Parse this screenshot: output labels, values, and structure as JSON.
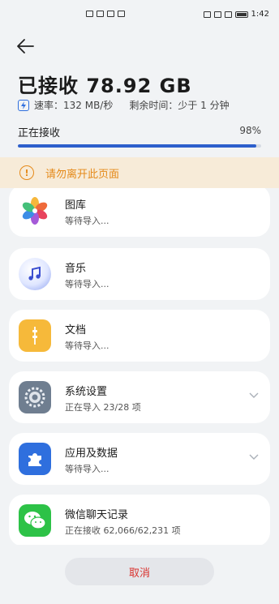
{
  "status_bar": {
    "time": "1:42"
  },
  "header": {
    "title": "已接收 78.92 GB",
    "speed": "速率：132 MB/秒",
    "remaining": "剩余时间：少于 1 分钟"
  },
  "progress": {
    "label": "正在接收",
    "percent_text": "98%",
    "percent": 98
  },
  "warning": {
    "text": "请勿离开此页面"
  },
  "items": [
    {
      "name": "图库",
      "status": "等待导入...",
      "icon": "gallery-icon"
    },
    {
      "name": "音乐",
      "status": "等待导入...",
      "icon": "music-icon"
    },
    {
      "name": "文档",
      "status": "等待导入...",
      "icon": "documents-icon"
    },
    {
      "name": "系统设置",
      "status": "正在导入 23/28 项",
      "icon": "settings-icon"
    },
    {
      "name": "应用及数据",
      "status": "等待导入...",
      "icon": "apps-data-icon"
    },
    {
      "name": "微信聊天记录",
      "status": "正在接收 62,066/62,231 项",
      "icon": "wechat-icon"
    }
  ],
  "colors": {
    "accent": "#2d5fcc",
    "warning": "#e58a1a",
    "cancel": "#d9332f"
  },
  "footer": {
    "cancel_label": "取消"
  }
}
